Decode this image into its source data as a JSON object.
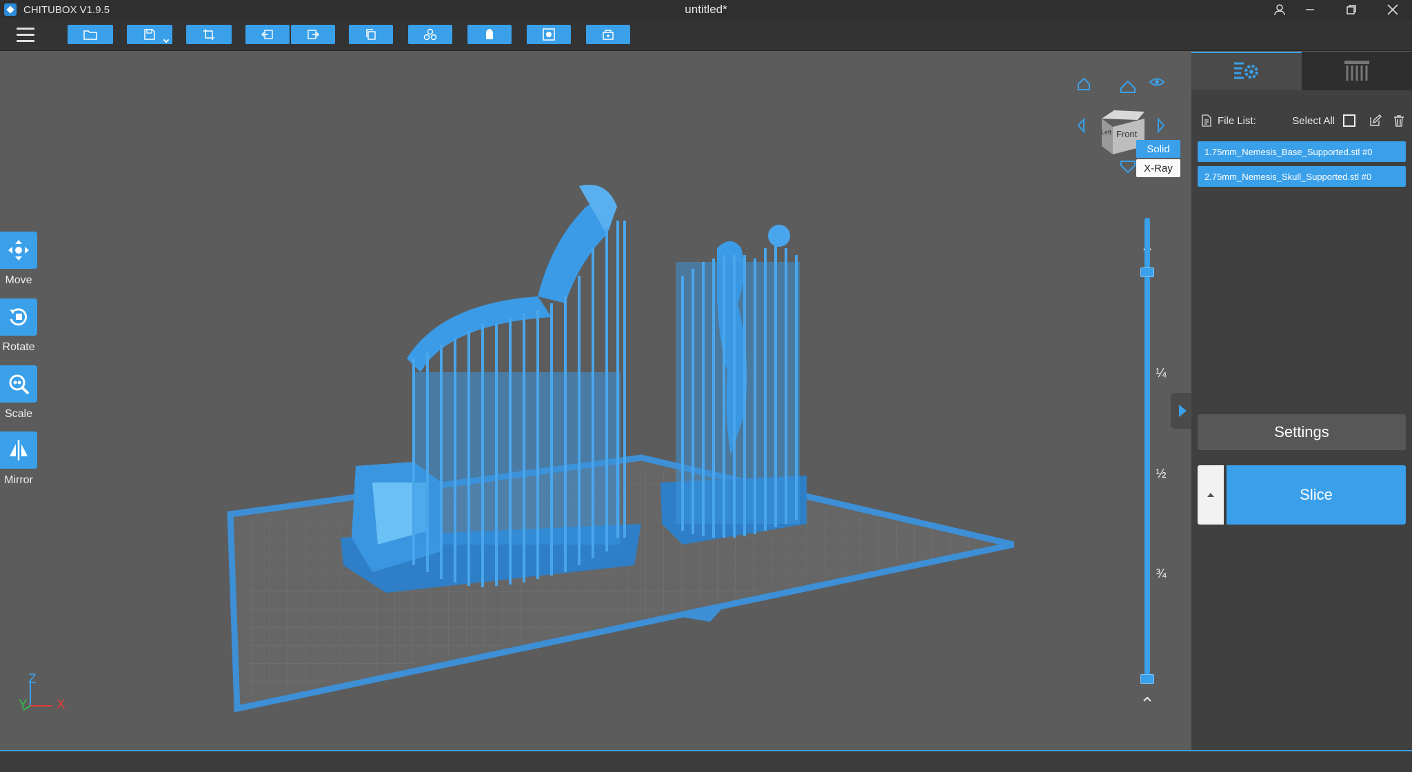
{
  "app": {
    "name": "CHITUBOX V1.9.5",
    "document_title": "untitled*"
  },
  "colors": {
    "accent": "#3aa0ea",
    "model": "#3b9be6",
    "background": "#5c5c5c",
    "panel": "#404040"
  },
  "toolbar": {
    "buttons": [
      {
        "name": "open-file-button",
        "icon": "folder-icon"
      },
      {
        "name": "save-button",
        "icon": "save-icon",
        "has_dropdown": true
      },
      {
        "name": "screenshot-button",
        "icon": "crop-icon"
      },
      {
        "name": "undo-button",
        "icon": "undo-icon"
      },
      {
        "name": "redo-button",
        "icon": "redo-icon"
      },
      {
        "name": "copy-button",
        "icon": "copy-icon"
      },
      {
        "name": "arrange-button",
        "icon": "arrange-icon"
      },
      {
        "name": "support-button",
        "icon": "support-icon"
      },
      {
        "name": "hollow-button",
        "icon": "hollow-icon"
      },
      {
        "name": "dig-hole-button",
        "icon": "dig-icon"
      }
    ]
  },
  "left_tools": [
    {
      "label": "Move",
      "icon": "move-icon"
    },
    {
      "label": "Rotate",
      "icon": "rotate-icon"
    },
    {
      "label": "Scale",
      "icon": "scale-icon"
    },
    {
      "label": "Mirror",
      "icon": "mirror-icon"
    }
  ],
  "view_cube": {
    "face_label": "Front",
    "side_label": "Left"
  },
  "view_modes": {
    "solid": "Solid",
    "xray": "X-Ray",
    "selected": "Solid"
  },
  "layer_slider": {
    "marks": [
      "¼",
      "½",
      "¾"
    ]
  },
  "axes": {
    "z": "Z",
    "y": "Y",
    "x": "X"
  },
  "panel": {
    "tabs": [
      {
        "name": "tab-print-settings",
        "icon": "settings-list-icon",
        "active": true
      },
      {
        "name": "tab-supports",
        "icon": "pillars-icon",
        "active": false
      }
    ],
    "file_list_label": "File List:",
    "select_all_label": "Select All",
    "files": [
      "1.75mm_Nemesis_Base_Supported.stl #0",
      "2.75mm_Nemesis_Skull_Supported.stl #0"
    ],
    "settings_label": "Settings",
    "slice_label": "Slice"
  }
}
